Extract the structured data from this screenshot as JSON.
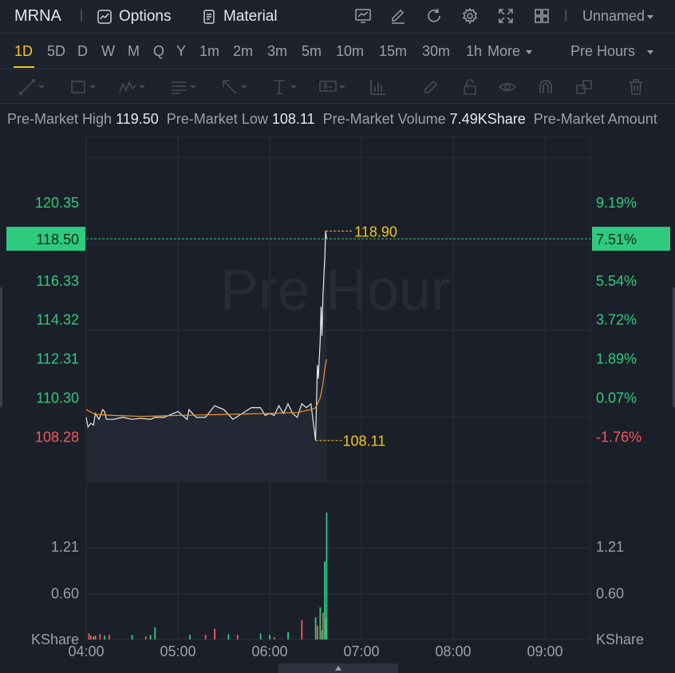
{
  "header": {
    "ticker": "MRNA",
    "options_label": "Options",
    "material_label": "Material",
    "layout_name": "Unnamed"
  },
  "periods": [
    "1D",
    "5D",
    "D",
    "W",
    "M",
    "Q",
    "Y",
    "1m",
    "2m",
    "3m",
    "5m",
    "10m",
    "15m",
    "30m",
    "1h"
  ],
  "active_period": "1D",
  "more_label": "More",
  "session_label": "Pre Hours",
  "stats": {
    "high_label": "Pre-Market High",
    "high_value": "119.50",
    "low_label": "Pre-Market Low",
    "low_value": "108.11",
    "volume_label": "Pre-Market Volume",
    "volume_value": "7.49KShare",
    "amount_label": "Pre-Market Amount"
  },
  "watermark": "Pre Hour",
  "colors": {
    "up": "#2ecb7f",
    "down": "#f25a5a",
    "accent": "#f5c518",
    "price_line": "#e8e8e8",
    "avg_line": "#f0961e",
    "bg": "#1b1f29",
    "grid": "#2a2f3a"
  },
  "chart_data": {
    "type": "line",
    "x_ticks": [
      "04:00",
      "05:00",
      "06:00",
      "07:00",
      "08:00",
      "09:00"
    ],
    "x_range_hours": [
      4.0,
      9.5
    ],
    "price_ticks": [
      "120.35",
      "116.33",
      "114.32",
      "112.31",
      "110.30",
      "108.28"
    ],
    "pct_ticks": [
      "9.19%",
      "5.54%",
      "3.72%",
      "1.89%",
      "0.07%",
      "-1.76%"
    ],
    "ylim": [
      106.0,
      122.7
    ],
    "current_price": "118.50",
    "current_pct": "7.51%",
    "high_marker": "118.90",
    "low_marker": "108.11",
    "volume_unit": "KShare",
    "volume_ticks": [
      "1.21",
      "0.60"
    ],
    "volume_max": 1.66,
    "series": [
      {
        "x": [
          4.0,
          4.02,
          4.05,
          4.08,
          4.1,
          4.14,
          4.18,
          4.2,
          4.22,
          4.3,
          4.4,
          4.5,
          4.6,
          4.7,
          4.75,
          4.8,
          4.85,
          4.9,
          5.0,
          5.1,
          5.12,
          5.2,
          5.3,
          5.4,
          5.5,
          5.6,
          5.8,
          5.9,
          5.95,
          6.0,
          6.05,
          6.1,
          6.15,
          6.2,
          6.25,
          6.3,
          6.35,
          6.4,
          6.45,
          6.5,
          6.51,
          6.52,
          6.53,
          6.55,
          6.56,
          6.57,
          6.58,
          6.59,
          6.6,
          6.61,
          6.62
        ],
        "values": [
          109.3,
          108.8,
          109.0,
          108.9,
          109.5,
          109.2,
          109.7,
          109.6,
          109.2,
          109.2,
          109.3,
          109.2,
          109.25,
          109.2,
          109.3,
          109.3,
          109.3,
          109.4,
          109.6,
          109.2,
          109.7,
          109.3,
          109.3,
          109.9,
          109.7,
          109.2,
          109.8,
          109.8,
          109.4,
          109.5,
          109.4,
          109.9,
          109.5,
          110.0,
          109.5,
          109.3,
          110.0,
          109.8,
          110.0,
          108.11,
          110.0,
          112.0,
          111.3,
          113.2,
          115.0,
          113.5,
          115.5,
          116.5,
          117.5,
          118.9,
          118.5
        ]
      },
      {
        "x": [
          4.0,
          4.1,
          4.3,
          4.6,
          5.0,
          5.5,
          6.0,
          6.3,
          6.45,
          6.5,
          6.55,
          6.58,
          6.6,
          6.62
        ],
        "values": [
          109.7,
          109.45,
          109.4,
          109.35,
          109.4,
          109.45,
          109.5,
          109.55,
          109.7,
          109.8,
          110.3,
          111.0,
          111.8,
          112.3
        ]
      }
    ],
    "volume": {
      "x": [
        4.03,
        4.05,
        4.08,
        4.1,
        4.15,
        4.2,
        4.25,
        4.5,
        4.65,
        4.7,
        4.75,
        5.13,
        5.3,
        5.4,
        5.55,
        5.65,
        5.9,
        6.0,
        6.05,
        6.2,
        6.35,
        6.5,
        6.52,
        6.55,
        6.57,
        6.58,
        6.6,
        6.61,
        6.62
      ],
      "values": [
        0.08,
        0.05,
        0.04,
        0.05,
        0.07,
        0.05,
        0.06,
        0.06,
        0.04,
        0.06,
        0.16,
        0.06,
        0.06,
        0.14,
        0.07,
        0.06,
        0.08,
        0.06,
        0.03,
        0.1,
        0.25,
        0.29,
        0.18,
        0.42,
        0.12,
        0.35,
        1.02,
        0.28,
        1.66
      ],
      "colors": [
        "down",
        "down",
        "up",
        "down",
        "down",
        "up",
        "down",
        "up",
        "down",
        "up",
        "up",
        "up",
        "down",
        "down",
        "up",
        "down",
        "up",
        "up",
        "down",
        "up",
        "down",
        "up",
        "down",
        "up",
        "up",
        "down",
        "up",
        "up",
        "up"
      ]
    }
  }
}
